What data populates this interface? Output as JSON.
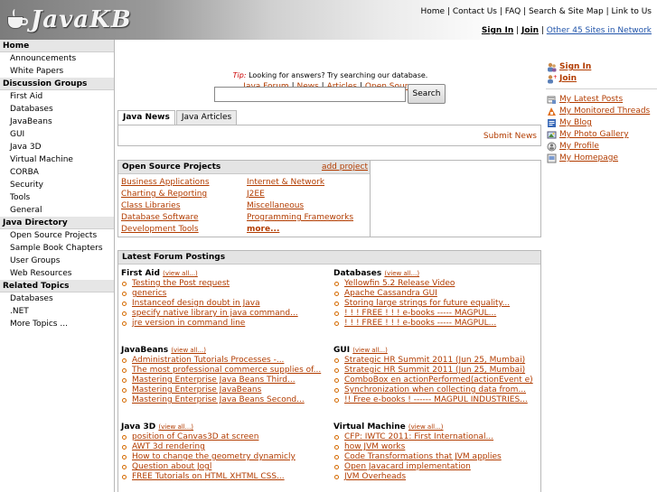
{
  "header": {
    "logo_text": "JavaKB",
    "top_nav": [
      "Home",
      "Contact Us",
      "FAQ",
      "Search & Site Map",
      "Link to Us"
    ],
    "sign_in": "Sign In",
    "join": "Join",
    "other_sites": "Other 45 Sites in Network"
  },
  "sidebar": {
    "sections": [
      {
        "title": "Home",
        "items": [
          "Announcements",
          "White Papers"
        ]
      },
      {
        "title": "Discussion Groups",
        "items": [
          "First Aid",
          "Databases",
          "JavaBeans",
          "GUI",
          "Java 3D",
          "Virtual Machine",
          "CORBA",
          "Security",
          "Tools",
          "General"
        ]
      },
      {
        "title": "Java Directory",
        "items": [
          "Open Source Projects",
          "Sample Book Chapters",
          "User Groups",
          "Web Resources"
        ]
      },
      {
        "title": "Related Topics",
        "items": [
          "Databases",
          ".NET",
          "More Topics ..."
        ]
      }
    ]
  },
  "main": {
    "links": [
      "Java Forum",
      "News",
      "Articles",
      "Open Source Software"
    ],
    "tip_label": "Tip:",
    "tip_text": "Looking for answers? Try searching our database.",
    "search": {
      "value": "",
      "placeholder": "",
      "button": "Search"
    },
    "tabs": [
      "Java News",
      "Java Articles"
    ],
    "submit_news": "Submit News",
    "osp": {
      "title": "Open Source Projects",
      "add_project": "add project",
      "col1": [
        "Business Applications",
        "Charting & Reporting",
        "Class Libraries",
        "Database Software",
        "Development Tools"
      ],
      "col2": [
        "Internet & Network",
        "J2EE",
        "Miscellaneous",
        "Programming Frameworks"
      ],
      "more": "more..."
    },
    "postings": {
      "title": "Latest Forum Postings",
      "view_all": "(view all...)",
      "groups": [
        {
          "name": "First Aid",
          "posts": [
            "Testing the Post request",
            "generics",
            "Instanceof design doubt in Java",
            "specify native library in java command...",
            "jre version in command line"
          ]
        },
        {
          "name": "Databases",
          "posts": [
            "Yellowfin 5.2 Release Video",
            "Apache Cassandra GUI",
            "Storing large strings for future equality...",
            "! ! ! FREE ! ! ! e-books ----- MAGPUL...",
            "! ! ! FREE ! ! ! e-books ----- MAGPUL..."
          ]
        },
        {
          "name": "JavaBeans",
          "posts": [
            "Administration Tutorials Processes -...",
            "The most professional commerce supplies of...",
            "Mastering Enterprise Java Beans Third...",
            "Mastering Enterprise JavaBeans",
            "Mastering Enterprise Java Beans Second..."
          ]
        },
        {
          "name": "GUI",
          "posts": [
            "Strategic HR Summit 2011 (Jun 25, Mumbai)",
            "Strategic HR Summit 2011 (Jun 25, Mumbai)",
            "ComboBox en actionPerformed(actionEvent e)",
            "Synchronization when collecting data from...",
            "!! Free e-books ! ------ MAGPUL INDUSTRIES..."
          ]
        },
        {
          "name": "Java 3D",
          "posts": [
            "position of Canvas3D at screen",
            "AWT 3d rendering",
            "How to change the geometry dynamicly",
            "Question about Jogl",
            "FREE Tutorials on HTML XHTML CSS..."
          ]
        },
        {
          "name": "Virtual Machine",
          "posts": [
            "CFP: IWTC 2011: First International...",
            "how JVM works",
            "Code Transformations that JVM applies",
            "Open Javacard implementation",
            "JVM Overheads"
          ]
        }
      ]
    }
  },
  "right": {
    "auth": [
      "Sign In",
      "Join"
    ],
    "links": [
      "My Latest Posts",
      "My Monitored Threads",
      "My Blog",
      "My Photo Gallery",
      "My Profile",
      "My Homepage"
    ]
  }
}
